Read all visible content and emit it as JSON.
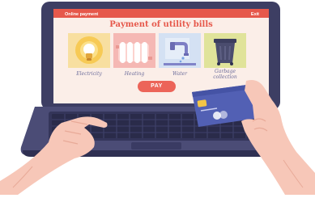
{
  "screen": {
    "topbar_left": "Online payment",
    "topbar_right": "Exit",
    "title": "Payment of utility bills",
    "tiles": [
      {
        "label": "Electricity",
        "icon": "lightbulb-icon",
        "bg": "#f8dfa0"
      },
      {
        "label": "Heating",
        "icon": "radiator-icon",
        "bg": "#f5b8b4"
      },
      {
        "label": "Water",
        "icon": "faucet-icon",
        "bg": "#d4e1f3"
      },
      {
        "label": "Garbage collection",
        "label_line1": "Garbage",
        "label_line2": "collection",
        "icon": "trash-bin-icon",
        "bg": "#e0e39a"
      }
    ],
    "pay_label": "PAY"
  },
  "colors": {
    "accent": "#e6584b",
    "laptop_body": "#3d3e63",
    "card": "#5260b4",
    "skin": "#f7c7b8"
  }
}
